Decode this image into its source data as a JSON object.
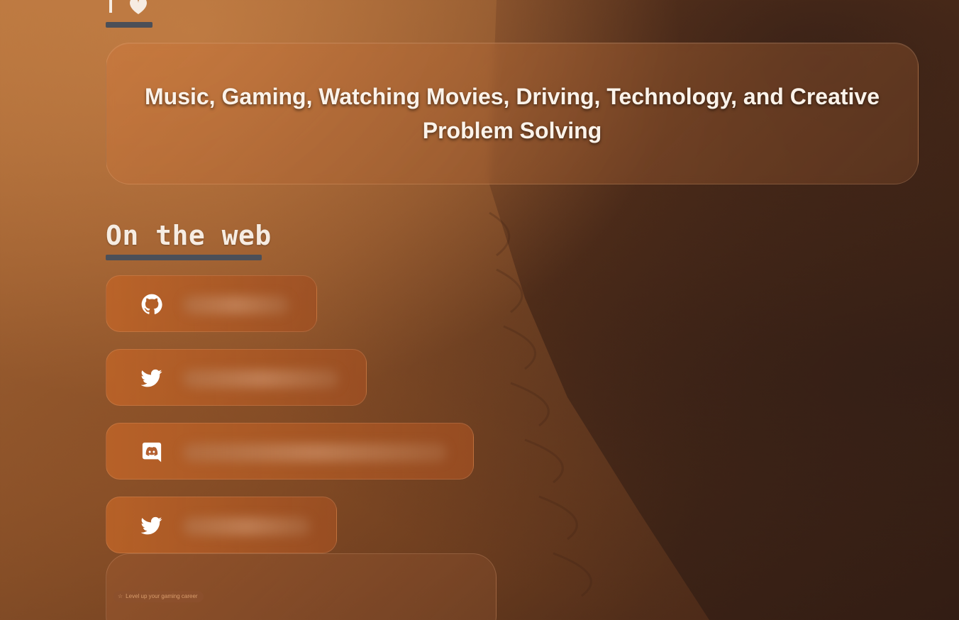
{
  "interests": {
    "text": "Music, Gaming, Watching Movies, Driving, Technology, and Creative Problem Solving"
  },
  "on_the_web": {
    "title": "On the web",
    "links": [
      {
        "icon": "github-icon",
        "label": ""
      },
      {
        "icon": "twitter-icon",
        "label": ""
      },
      {
        "icon": "discord-icon",
        "label": ""
      },
      {
        "icon": "twitter-icon",
        "label": ""
      }
    ]
  },
  "preview": {
    "badge_text": "Level up your gaming career"
  },
  "colors": {
    "accent_underline": "#4b4f58",
    "card_orange": "#be6428",
    "text_light": "#fbf3ea"
  }
}
